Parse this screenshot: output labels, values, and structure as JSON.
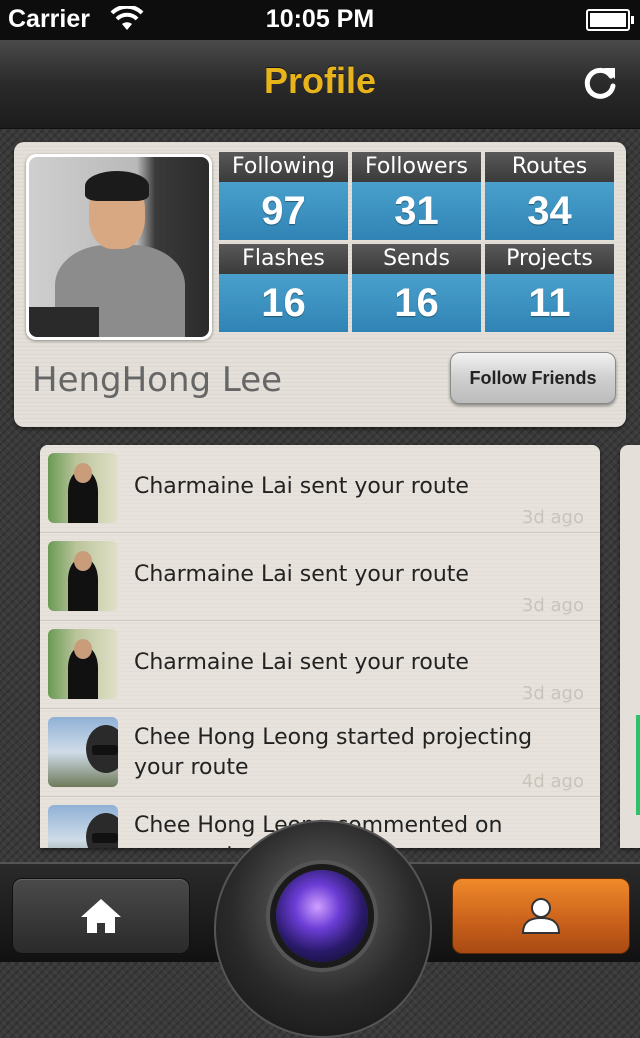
{
  "status_bar": {
    "carrier": "Carrier",
    "time": "10:05 PM"
  },
  "navbar": {
    "title": "Profile",
    "refresh_icon": "refresh-icon"
  },
  "profile": {
    "name": "HengHong Lee",
    "follow_button": "Follow Friends",
    "stats": [
      {
        "label": "Following",
        "value": "97"
      },
      {
        "label": "Followers",
        "value": "31"
      },
      {
        "label": "Routes",
        "value": "34"
      },
      {
        "label": "Flashes",
        "value": "16"
      },
      {
        "label": "Sends",
        "value": "16"
      },
      {
        "label": "Projects",
        "value": "11"
      }
    ]
  },
  "feed": [
    {
      "text": "Charmaine Lai sent your route",
      "time": "3d ago"
    },
    {
      "text": "Charmaine Lai sent your route",
      "time": "3d ago"
    },
    {
      "text": "Charmaine Lai sent your route",
      "time": "3d ago"
    },
    {
      "text": "Chee Hong Leong started projecting your route",
      "time": "4d ago"
    },
    {
      "text": "Chee Hong Leong commented on your route",
      "time": ""
    }
  ],
  "colors": {
    "accent": "#e8b41b",
    "stat_blue": "#3a94c4",
    "active_tab": "#e07a25"
  },
  "tabbar": {
    "home_icon": "home-icon",
    "camera_icon": "camera-icon",
    "profile_icon": "person-icon"
  }
}
